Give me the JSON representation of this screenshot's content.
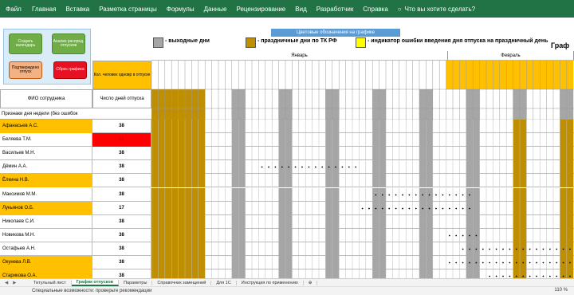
{
  "ribbon": {
    "file": "Файл",
    "tabs": [
      "Главная",
      "Вставка",
      "Разметка страницы",
      "Формулы",
      "Данные",
      "Рецензирование",
      "Вид",
      "Разработчик",
      "Справка"
    ],
    "tell_me": "Что вы хотите сделать?"
  },
  "panel": {
    "btn_create": "Создать календарь",
    "btn_analysis": "Анализ распред. отпусков",
    "btn_confirm": "Подтверждено отпуск",
    "btn_reset": "Сброс графика"
  },
  "legend": {
    "title": "Цветовые обозначения на графике",
    "weekend": "- выходные дни",
    "holiday": "- праздничные дни по ТК РФ",
    "error": "- индикатор ошибки введения дня отпуска на праздничный день",
    "graf": "Граф"
  },
  "colors": {
    "weekend": "#a6a6a6",
    "holiday": "#bf8f00",
    "error": "#ffff00",
    "orange": "#ffc000",
    "red": "#ff0000",
    "accent": "#217346"
  },
  "table": {
    "count_header": "Кол. человек одновр в отпуске",
    "fio_header": "ФИО сотрудника",
    "days_header": "Число дней отпуска",
    "signs": "Признаки дня недели (без ошибок",
    "months": [
      "Январь",
      "Февраль"
    ],
    "employees": [
      {
        "name": "Афанасьев А.С.",
        "days": "38",
        "style": "orange"
      },
      {
        "name": "Беляева Т.М.",
        "days": "38",
        "style": "red"
      },
      {
        "name": "Васильев М.Н.",
        "days": "38",
        "style": "none"
      },
      {
        "name": "Дёмин А.А.",
        "days": "38",
        "style": "none"
      },
      {
        "name": "Ёлкина Н.В.",
        "days": "38",
        "style": "orange"
      },
      {
        "name": "Максимов М.М.",
        "days": "38",
        "style": "none"
      },
      {
        "name": "Лукьянов О.Б.",
        "days": "17",
        "style": "orange"
      },
      {
        "name": "Николаев С.И.",
        "days": "38",
        "style": "none"
      },
      {
        "name": "Новикова М.Н.",
        "days": "38",
        "style": "none"
      },
      {
        "name": "Остафьев А.Н.",
        "days": "38",
        "style": "none"
      },
      {
        "name": "Окунева Л.В.",
        "days": "38",
        "style": "orange"
      },
      {
        "name": "Старикова О.А.",
        "days": "38",
        "style": "orange"
      }
    ]
  },
  "sheets": {
    "tabs": [
      "Титульный лист",
      "График отпусков",
      "Параметры",
      "Справочник замещений",
      "Для 1С",
      "Инструкция по применению"
    ],
    "active": 1
  },
  "status": {
    "text": "Специальные возможности: проверьте рекомендации",
    "zoom": "110 %"
  }
}
